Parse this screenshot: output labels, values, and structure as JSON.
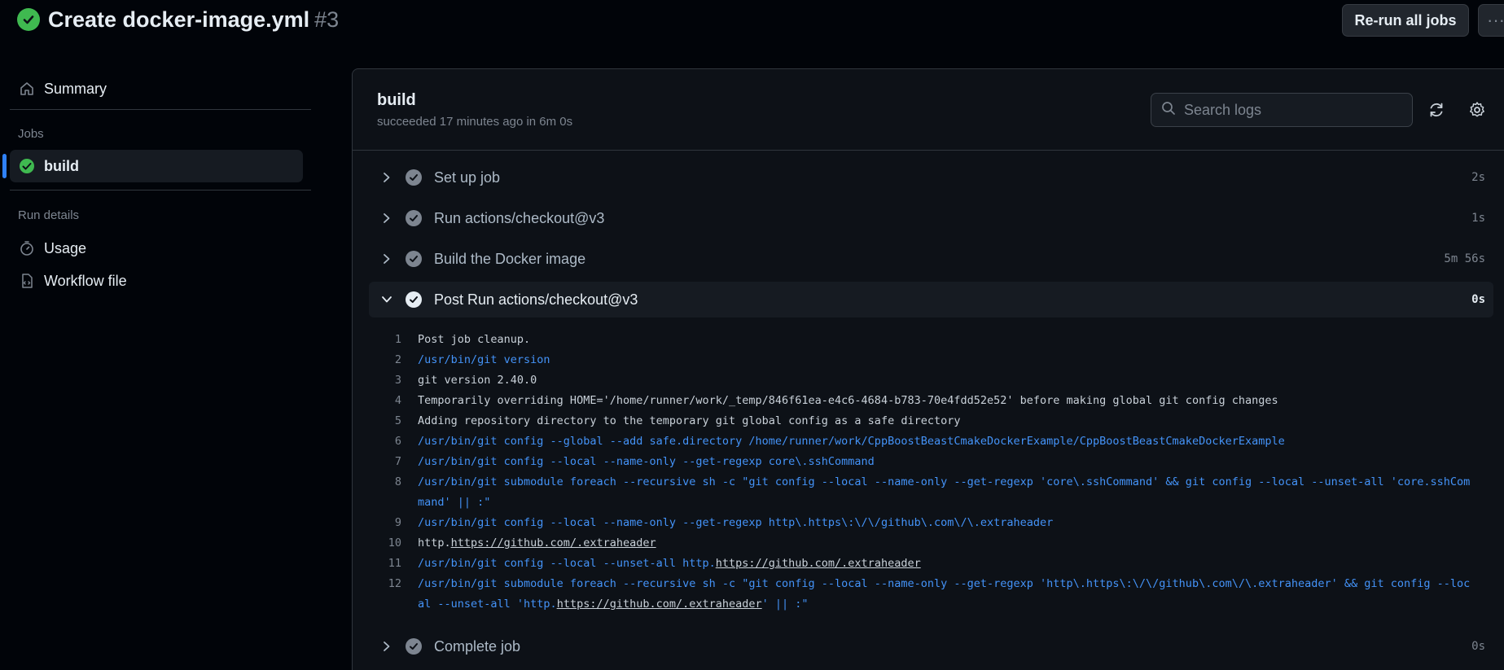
{
  "header": {
    "title": "Create docker-image.yml",
    "run_number": "#3",
    "rerun_label": "Re-run all jobs",
    "more_label": "···"
  },
  "sidebar": {
    "summary_label": "Summary",
    "jobs_heading": "Jobs",
    "job_label": "build",
    "run_details_heading": "Run details",
    "usage_label": "Usage",
    "workflow_label": "Workflow file"
  },
  "job": {
    "title": "build",
    "subtitle": "succeeded 17 minutes ago in 6m 0s",
    "search_placeholder": "Search logs"
  },
  "steps": [
    {
      "name": "Set up job",
      "duration": "2s"
    },
    {
      "name": "Run actions/checkout@v3",
      "duration": "1s"
    },
    {
      "name": "Build the Docker image",
      "duration": "5m 56s"
    },
    {
      "name": "Post Run actions/checkout@v3",
      "duration": "0s"
    },
    {
      "name": "Complete job",
      "duration": "0s"
    }
  ],
  "log_lines": [
    {
      "n": "1",
      "text": "Post job cleanup."
    },
    {
      "n": "2",
      "text": "/usr/bin/git version"
    },
    {
      "n": "3",
      "text": "git version 2.40.0"
    },
    {
      "n": "4",
      "text": "Temporarily overriding HOME='/home/runner/work/_temp/846f61ea-e4c6-4684-b783-70e4fdd52e52' before making global git config changes"
    },
    {
      "n": "5",
      "text": "Adding repository directory to the temporary git global config as a safe directory"
    },
    {
      "n": "6",
      "text": "/usr/bin/git config --global --add safe.directory /home/runner/work/CppBoostBeastCmakeDockerExample/CppBoostBeastCmakeDockerExample"
    },
    {
      "n": "7",
      "text": "/usr/bin/git config --local --name-only --get-regexp core\\.sshCommand"
    },
    {
      "n": "8",
      "text": "/usr/bin/git submodule foreach --recursive sh -c \"git config --local --name-only --get-regexp 'core\\.sshCommand' && git config --local --unset-all 'core.sshCommand' || :\""
    },
    {
      "n": "9",
      "text": "/usr/bin/git config --local --name-only --get-regexp http\\.https\\:\\/\\/github\\.com\\/\\.extraheader"
    },
    {
      "n": "10",
      "prefix": "http.",
      "link": "https://github.com/.extraheader"
    },
    {
      "n": "11",
      "prefix": "/usr/bin/git config --local --unset-all http.",
      "link": "https://github.com/.extraheader"
    },
    {
      "n": "12",
      "prefix": "/usr/bin/git submodule foreach --recursive sh -c \"git config --local --name-only --get-regexp 'http\\.https\\:\\/\\/github\\.com\\/\\.extraheader' && git config --local --unset-all 'http.",
      "link": "https://github.com/.extraheader",
      "suffix": "' || :\""
    }
  ],
  "colors": {
    "success": "#3fb950",
    "link_blue": "#4493f8",
    "active_bar": "#2f81f7"
  }
}
